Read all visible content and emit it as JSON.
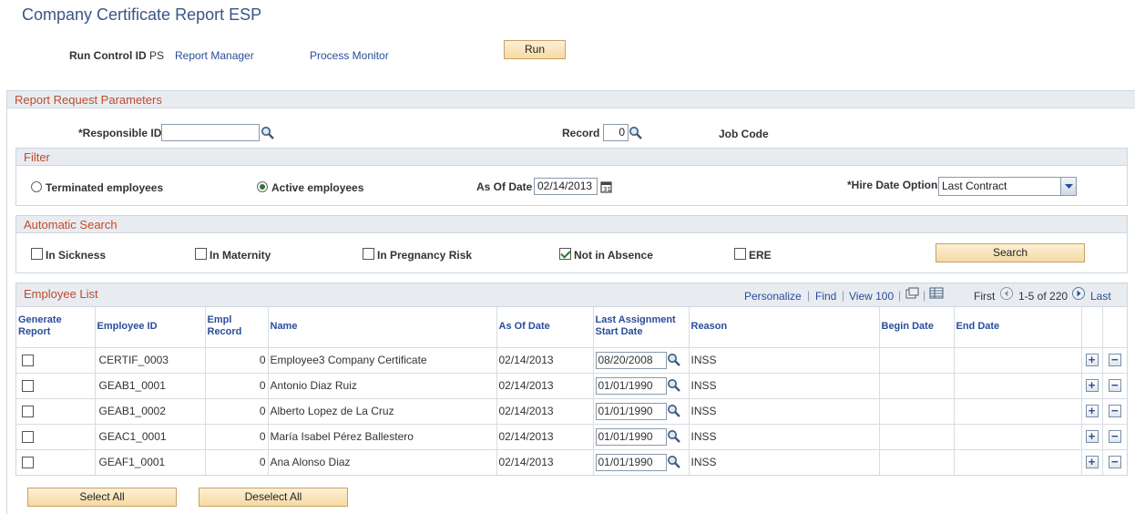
{
  "page": {
    "title": "Company Certificate Report ESP"
  },
  "run_control": {
    "label": "Run Control ID",
    "value": "PS",
    "report_manager": "Report Manager",
    "process_monitor": "Process Monitor",
    "run_button": "Run"
  },
  "params": {
    "title": "Report Request Parameters",
    "responsible_label": "*Responsible ID",
    "responsible_value": "",
    "record_label": "Record",
    "record_value": "0",
    "job_code_label": "Job Code"
  },
  "filter": {
    "title": "Filter",
    "terminated": "Terminated employees",
    "active": "Active employees",
    "as_of_label": "As Of Date",
    "as_of_value": "02/14/2013",
    "hire_label": "*Hire Date Option",
    "hire_value": "Last Contract"
  },
  "auto": {
    "title": "Automatic Search",
    "in_sickness": "In Sickness",
    "in_maternity": "In Maternity",
    "in_pregnancy": "In Pregnancy Risk",
    "not_absence": "Not in Absence",
    "ere": "ERE",
    "search_button": "Search"
  },
  "employees": {
    "title": "Employee List",
    "personalize": "Personalize",
    "find": "Find",
    "view100": "View 100",
    "first": "First",
    "range": "1-5 of 220",
    "last": "Last",
    "columns": {
      "generate": "Generate Report",
      "emplid": "Employee ID",
      "emplrcd": "Empl Record",
      "name": "Name",
      "asof": "As Of Date",
      "lastassign": "Last Assignment Start Date",
      "reason": "Reason",
      "begin": "Begin Date",
      "end": "End Date"
    },
    "rows": [
      {
        "emplid": "CERTIF_0003",
        "rcd": "0",
        "name": "Employee3 Company Certificate",
        "asof": "02/14/2013",
        "start": "08/20/2008",
        "reason": "INSS"
      },
      {
        "emplid": "GEAB1_0001",
        "rcd": "0",
        "name": "Antonio Diaz Ruiz",
        "asof": "02/14/2013",
        "start": "01/01/1990",
        "reason": "INSS"
      },
      {
        "emplid": "GEAB1_0002",
        "rcd": "0",
        "name": "Alberto Lopez de La Cruz",
        "asof": "02/14/2013",
        "start": "01/01/1990",
        "reason": "INSS"
      },
      {
        "emplid": "GEAC1_0001",
        "rcd": "0",
        "name": "María Isabel Pérez Ballestero",
        "asof": "02/14/2013",
        "start": "01/01/1990",
        "reason": "INSS"
      },
      {
        "emplid": "GEAF1_0001",
        "rcd": "0",
        "name": "Ana Alonso Diaz",
        "asof": "02/14/2013",
        "start": "01/01/1990",
        "reason": "INSS"
      }
    ]
  },
  "footer": {
    "select_all": "Select All",
    "deselect_all": "Deselect All"
  }
}
